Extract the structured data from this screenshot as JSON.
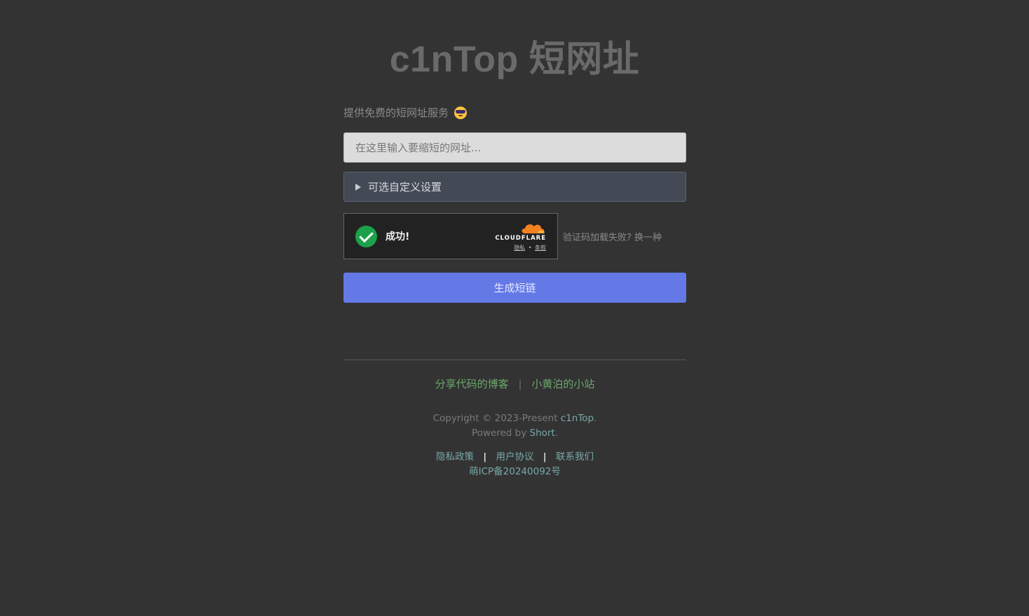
{
  "header": {
    "title": "c1nTop 短网址"
  },
  "form": {
    "tagline": "提供免费的短网址服务",
    "tagline_emoji": "smiling-face-with-sunglasses-icon",
    "url_placeholder": "在这里输入要缩短的网址...",
    "custom_settings_label": "可选自定义设置",
    "submit_label": "生成短链"
  },
  "captcha": {
    "status": "成功!",
    "brand": "CLOUDFLARE",
    "privacy": "隐私",
    "dot": "•",
    "terms": "条款",
    "fallback": "验证码加载失败? 换一种"
  },
  "footer": {
    "friend_links": [
      "分享代码的博客",
      "小黄泊的小站"
    ],
    "friend_sep": "|",
    "copyright_prefix": "Copyright © 2023-Present ",
    "copyright_site": "c1nTop",
    "period": ".",
    "powered_prefix": "Powered by ",
    "powered_name": "Short",
    "legal_links": [
      "隐私政策",
      "用户协议",
      "联系我们"
    ],
    "legal_sep": "|",
    "icp": "萌ICP备20240092号"
  },
  "colors": {
    "background": "#333333",
    "accent_button": "#6479e6",
    "link_green": "#6aa86a",
    "captcha_success": "#1ca14b",
    "cloudflare_orange": "#f48120"
  }
}
